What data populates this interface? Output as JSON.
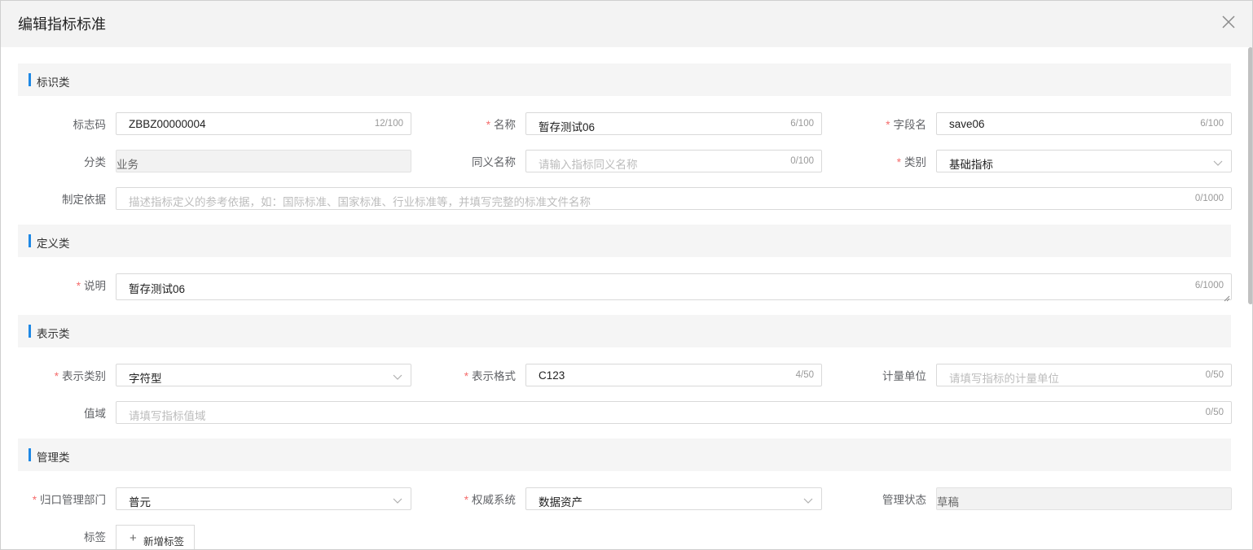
{
  "dialog": {
    "title": "编辑指标标准"
  },
  "sections": {
    "identification": "标识类",
    "definition": "定义类",
    "representation": "表示类",
    "management": "管理类"
  },
  "fields": {
    "code": {
      "label": "标志码",
      "value": "ZBBZ00000004",
      "count": "12/100"
    },
    "name": {
      "label": "名称",
      "value": "暂存测试06",
      "count": "6/100"
    },
    "field_name": {
      "label": "字段名",
      "value": "save06",
      "count": "6/100"
    },
    "category": {
      "label": "分类",
      "value": "业务"
    },
    "synonym": {
      "label": "同义名称",
      "placeholder": "请输入指标同义名称",
      "count": "0/100"
    },
    "type": {
      "label": "类别",
      "value": "基础指标"
    },
    "basis": {
      "label": "制定依据",
      "placeholder": "描述指标定义的参考依据，如：国际标准、国家标准、行业标准等，并填写完整的标准文件名称",
      "count": "0/1000"
    },
    "description": {
      "label": "说明",
      "value": "暂存测试06",
      "count": "6/1000"
    },
    "repr_type": {
      "label": "表示类别",
      "value": "字符型"
    },
    "repr_format": {
      "label": "表示格式",
      "value": "C123",
      "count": "4/50"
    },
    "unit": {
      "label": "计量单位",
      "placeholder": "请填写指标的计量单位",
      "count": "0/50"
    },
    "value_domain": {
      "label": "值域",
      "placeholder": "请填写指标值域",
      "count": "0/50"
    },
    "dept": {
      "label": "归口管理部门",
      "value": "普元"
    },
    "authority": {
      "label": "权威系统",
      "value": "数据资产"
    },
    "status": {
      "label": "管理状态",
      "value": "草稿"
    },
    "tags": {
      "label": "标签",
      "add_label": "新增标签"
    }
  },
  "required_mark": "*",
  "colors": {
    "accent": "#1e88e5",
    "required": "#f56c6c",
    "section_bg": "#f5f5f5",
    "header_bg": "#f3f3f3"
  }
}
